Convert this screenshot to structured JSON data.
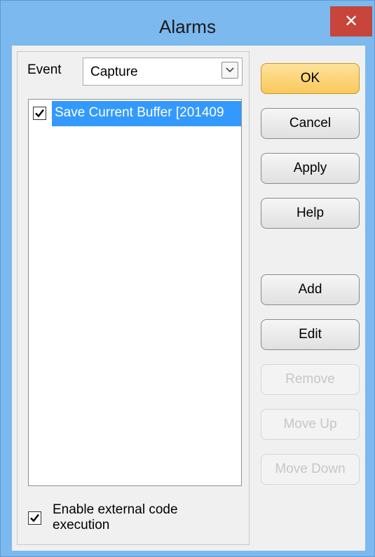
{
  "window": {
    "title": "Alarms",
    "close_glyph": "✕"
  },
  "event": {
    "label": "Event",
    "selected": "Capture"
  },
  "alarm_list": {
    "items": [
      {
        "label": "Save Current Buffer [201409",
        "checked": true,
        "selected": true
      }
    ]
  },
  "external_code": {
    "label": "Enable external code execution",
    "checked": true
  },
  "buttons": {
    "ok": "OK",
    "cancel": "Cancel",
    "apply": "Apply",
    "help": "Help",
    "add": "Add",
    "edit": "Edit",
    "remove": "Remove",
    "move_up": "Move Up",
    "move_down": "Move Down"
  },
  "colors": {
    "title_bar": "#7cb9ef",
    "close_button": "#c7453a",
    "selection": "#3399ff",
    "default_button": "#f8c95c"
  },
  "icons": {
    "close": "close-icon",
    "dropdown": "chevron-down-icon",
    "check": "checkmark-icon"
  }
}
